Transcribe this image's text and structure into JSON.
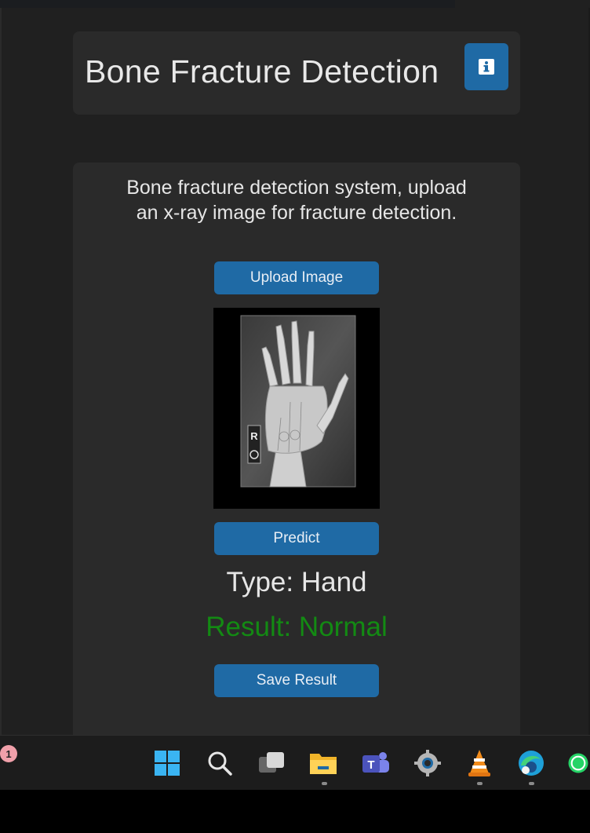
{
  "app": {
    "title": "Bone Fracture Detection"
  },
  "main": {
    "description": "Bone fracture detection system, upload an x-ray image for fracture detection.",
    "upload_label": "Upload Image",
    "predict_label": "Predict",
    "type_text": "Type: Hand",
    "result_text": "Result: Normal",
    "save_label": "Save Result",
    "xray_marker": "R"
  },
  "taskbar": {
    "badge_count": "1",
    "icons": [
      "windows-start-icon",
      "search-icon",
      "task-view-icon",
      "file-explorer-icon",
      "teams-icon",
      "settings-icon",
      "vlc-icon",
      "edge-icon",
      "whatsapp-icon"
    ]
  },
  "colors": {
    "accent": "#1f6aa5",
    "result_normal": "#138a13",
    "card_bg": "#2a2a2a",
    "window_bg": "#202020"
  }
}
